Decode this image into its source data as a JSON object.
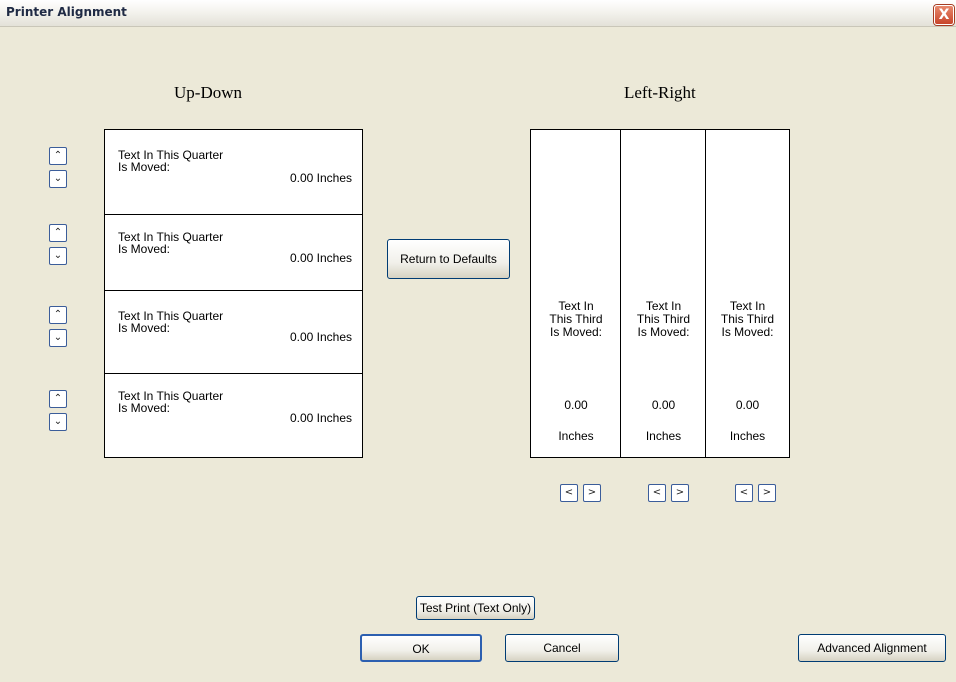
{
  "window": {
    "title": "Printer Alignment",
    "close_glyph": "X"
  },
  "up_down": {
    "title": "Up-Down",
    "quarters": [
      {
        "line1": "Text In This Quarter",
        "line2": "Is Moved:",
        "value": "0.00 Inches"
      },
      {
        "line1": "Text In This Quarter",
        "line2": "Is Moved:",
        "value": "0.00 Inches"
      },
      {
        "line1": "Text In This Quarter",
        "line2": "Is Moved:",
        "value": "0.00 Inches"
      },
      {
        "line1": "Text In This Quarter",
        "line2": "Is Moved:",
        "value": "0.00 Inches"
      }
    ],
    "up_glyph": "⌃",
    "down_glyph": "⌄"
  },
  "left_right": {
    "title": "Left-Right",
    "thirds": [
      {
        "line1": "Text In",
        "line2": "This Third",
        "line3": "Is Moved:",
        "value": "0.00",
        "unit": "Inches"
      },
      {
        "line1": "Text In",
        "line2": "This Third",
        "line3": "Is Moved:",
        "value": "0.00",
        "unit": "Inches"
      },
      {
        "line1": "Text In",
        "line2": "This Third",
        "line3": "Is Moved:",
        "value": "0.00",
        "unit": "Inches"
      }
    ],
    "left_glyph": "<",
    "right_glyph": ">"
  },
  "buttons": {
    "return_defaults": "Return to Defaults",
    "test_print": "Test Print (Text Only)",
    "ok": "OK",
    "cancel": "Cancel",
    "advanced": "Advanced Alignment"
  },
  "colors": {
    "dialog_bg": "#ece9d8",
    "close_red": "#c8452a",
    "button_border": "#003c74"
  }
}
